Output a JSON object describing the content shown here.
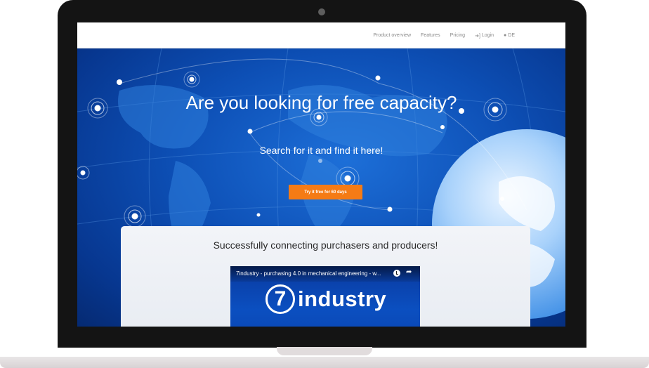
{
  "nav": {
    "items": [
      {
        "label": "Product overview",
        "icon": ""
      },
      {
        "label": "Features",
        "icon": ""
      },
      {
        "label": "Pricing",
        "icon": ""
      },
      {
        "label": "Login",
        "icon": "sign-in-icon"
      },
      {
        "label": "DE",
        "icon": "globe-icon"
      }
    ]
  },
  "hero": {
    "title": "Are you looking for free capacity?",
    "subtitle": "Search for it and find it here!",
    "cta_label": "Try it free for 60 days"
  },
  "card": {
    "heading": "Successfully connecting purchasers and producers!",
    "video": {
      "title": "7industry - purchasing 4.0 in mechanical engineering - w...",
      "logo_number": "7",
      "logo_word": "industry"
    }
  },
  "colors": {
    "cta": "#f57b15",
    "hero_blue": "#0d4fb5",
    "nav_text": "#8a8a8a",
    "laptop_frame": "#141414"
  }
}
